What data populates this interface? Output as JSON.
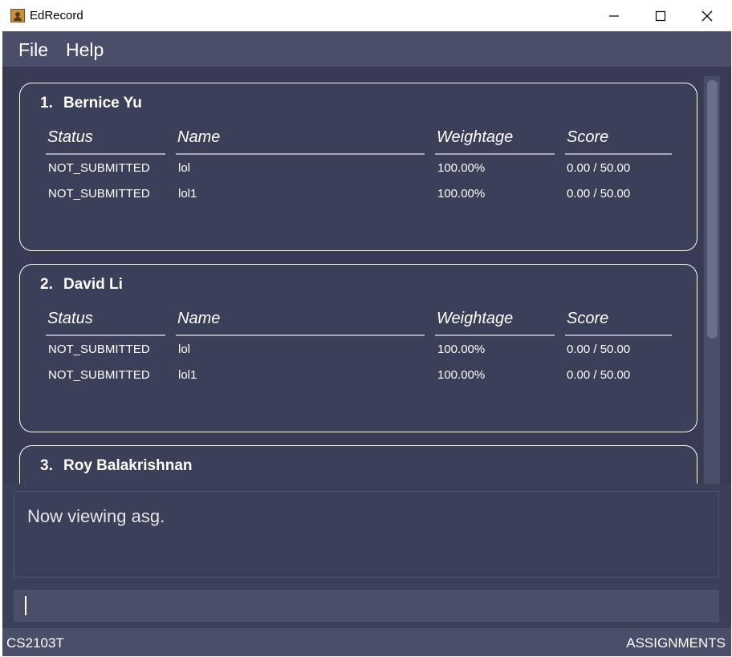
{
  "window": {
    "title": "EdRecord",
    "icon": "contact-book-icon"
  },
  "menu": {
    "file": "File",
    "help": "Help"
  },
  "columns": {
    "status": "Status",
    "name": "Name",
    "weightage": "Weightage",
    "score": "Score"
  },
  "students": [
    {
      "index": "1.",
      "name": "Bernice Yu",
      "rows": [
        {
          "status": "NOT_SUBMITTED",
          "name": "lol",
          "weightage": "100.00%",
          "score": "0.00 / 50.00"
        },
        {
          "status": "NOT_SUBMITTED",
          "name": "lol1",
          "weightage": "100.00%",
          "score": "0.00 / 50.00"
        }
      ]
    },
    {
      "index": "2.",
      "name": "David Li",
      "rows": [
        {
          "status": "NOT_SUBMITTED",
          "name": "lol",
          "weightage": "100.00%",
          "score": "0.00 / 50.00"
        },
        {
          "status": "NOT_SUBMITTED",
          "name": "lol1",
          "weightage": "100.00%",
          "score": "0.00 / 50.00"
        }
      ]
    },
    {
      "index": "3.",
      "name": "Roy Balakrishnan",
      "rows": []
    }
  ],
  "result": {
    "message": "Now viewing asg."
  },
  "command": {
    "value": ""
  },
  "status": {
    "module": "CS2103T",
    "view": "ASSIGNMENTS"
  },
  "colors": {
    "background": "#3c3f58",
    "panel": "#4a4e69",
    "text": "#ffffff"
  }
}
